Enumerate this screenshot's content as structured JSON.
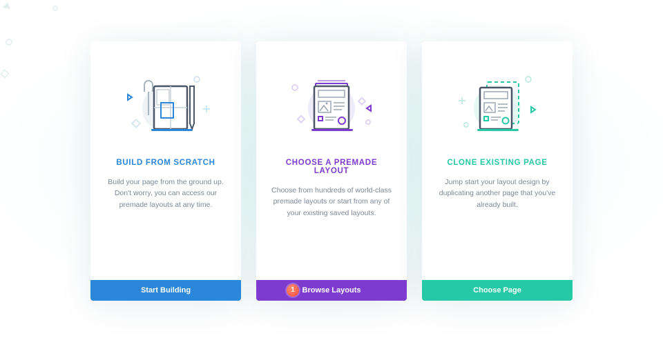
{
  "cards": [
    {
      "title": "BUILD FROM SCRATCH",
      "desc": "Build your page from the ground up. Don't worry, you can access our premade layouts at any time.",
      "button": "Start Building"
    },
    {
      "title": "CHOOSE A PREMADE LAYOUT",
      "desc": "Choose from hundreds of world-class premade layouts or start from any of your existing saved layouts.",
      "button": "Browse Layouts",
      "badge": "1"
    },
    {
      "title": "CLONE EXISTING PAGE",
      "desc": "Jump start your layout design by duplicating another page that you've already built.",
      "button": "Choose Page"
    }
  ],
  "colors": {
    "card1_accent": "#2b87da",
    "card2_accent": "#7e3bd0",
    "card3_accent": "#25c9a6"
  }
}
